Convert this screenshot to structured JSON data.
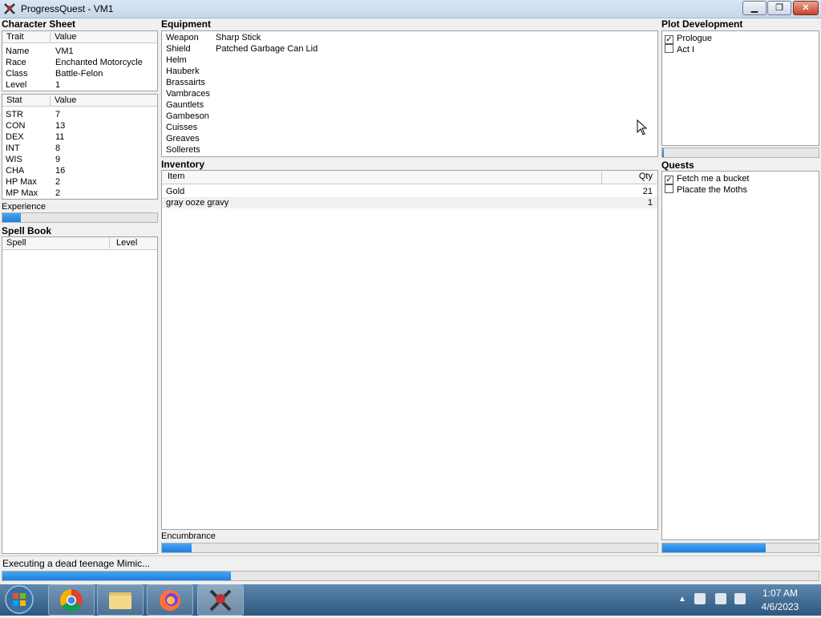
{
  "window": {
    "title": "ProgressQuest - VM1",
    "min_label": "▁",
    "max_label": "❐",
    "close_label": "✕"
  },
  "character_sheet": {
    "title": "Character Sheet",
    "trait_header": "Trait",
    "value_header": "Value",
    "traits": [
      {
        "trait": "Name",
        "value": "VM1"
      },
      {
        "trait": "Race",
        "value": "Enchanted Motorcycle"
      },
      {
        "trait": "Class",
        "value": "Battle-Felon"
      },
      {
        "trait": "Level",
        "value": "1"
      }
    ],
    "stat_header": "Stat",
    "stat_value_header": "Value",
    "stats": [
      {
        "stat": "STR",
        "value": "7"
      },
      {
        "stat": "CON",
        "value": "13"
      },
      {
        "stat": "DEX",
        "value": "11"
      },
      {
        "stat": "INT",
        "value": "8"
      },
      {
        "stat": "WIS",
        "value": "9"
      },
      {
        "stat": "CHA",
        "value": "16"
      },
      {
        "stat": "HP Max",
        "value": "2"
      },
      {
        "stat": "MP Max",
        "value": "2"
      }
    ],
    "experience_label": "Experience",
    "experience_progress": 0.12
  },
  "spell_book": {
    "title": "Spell Book",
    "spell_header": "Spell",
    "level_header": "Level"
  },
  "equipment": {
    "title": "Equipment",
    "slots": [
      {
        "slot": "Weapon",
        "item": "Sharp Stick"
      },
      {
        "slot": "Shield",
        "item": "Patched Garbage Can Lid"
      },
      {
        "slot": "Helm",
        "item": ""
      },
      {
        "slot": "Hauberk",
        "item": ""
      },
      {
        "slot": "Brassairts",
        "item": ""
      },
      {
        "slot": "Vambraces",
        "item": ""
      },
      {
        "slot": "Gauntlets",
        "item": ""
      },
      {
        "slot": "Gambeson",
        "item": ""
      },
      {
        "slot": "Cuisses",
        "item": ""
      },
      {
        "slot": "Greaves",
        "item": ""
      },
      {
        "slot": "Sollerets",
        "item": ""
      }
    ]
  },
  "inventory": {
    "title": "Inventory",
    "item_header": "Item",
    "qty_header": "Qty",
    "items": [
      {
        "item": "Gold",
        "qty": "21"
      },
      {
        "item": "gray ooze gravy",
        "qty": "1"
      }
    ],
    "encumbrance_label": "Encumbrance",
    "encumbrance_progress": 0.06
  },
  "plot": {
    "title": "Plot Development",
    "acts": [
      {
        "label": "Prologue",
        "checked": true
      },
      {
        "label": "Act I",
        "checked": false
      }
    ],
    "progress": 0.01
  },
  "quests": {
    "title": "Quests",
    "items": [
      {
        "label": "Fetch me a bucket",
        "checked": true
      },
      {
        "label": "Placate the Moths",
        "checked": false
      }
    ],
    "progress": 0.66
  },
  "status": {
    "text": "Executing a dead teenage Mimic...",
    "progress": 0.28
  },
  "taskbar": {
    "time": "1:07 AM",
    "date": "4/6/2023"
  },
  "colors": {
    "progress": "#1b7fe0",
    "titlebar": "#c6d6ea",
    "taskbar": "#2f577e"
  }
}
